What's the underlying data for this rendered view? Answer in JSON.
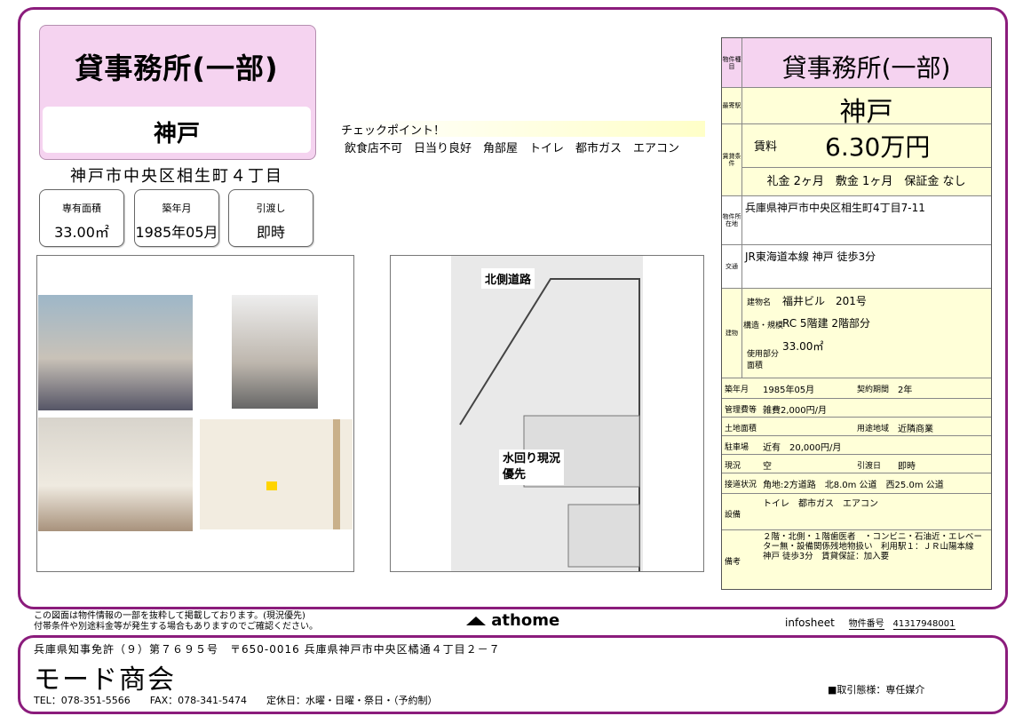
{
  "header": {
    "title": "貸事務所(一部)",
    "area": "神戸",
    "address": "神戸市中央区相生町４丁目"
  },
  "badges": [
    {
      "label": "専有面積",
      "value": "33.00㎡"
    },
    {
      "label": "築年月",
      "value": "1985年05月"
    },
    {
      "label": "引渡し",
      "value": "即時"
    }
  ],
  "checkpoint": {
    "title": "チェックポイント！",
    "items": "飲食店不可　日当り良好　角部屋　トイレ　都市ガス　エアコン"
  },
  "floorplan": {
    "north_road": "北側道路",
    "note1": "水回り現況",
    "note2": "優先"
  },
  "table": {
    "type_label": "物件種目",
    "type": "貸事務所(一部)",
    "station_label": "最寄駅",
    "station": "神戸",
    "rent_cond_label": "賃貸条件",
    "rent_label": "賃料",
    "rent": "6.30万円",
    "deposit": "礼金 2ヶ月　敷金 1ヶ月　保証金 なし",
    "loc_label": "物件所在地",
    "location": "兵庫県神戸市中央区相生町4丁目7-11",
    "access_label": "交通",
    "access": "JR東海道本線 神戸 徒歩3分",
    "bld_label": "建物",
    "bld_name_label": "建物名",
    "bld_name": "福井ビル　201号",
    "struct_label": "構造・規模",
    "struct": "RC 5階建 2階部分",
    "usage_label": "使用部分面積",
    "usage": "33.00㎡",
    "built_label": "築年月",
    "built": "1985年05月",
    "term_label": "契約期間",
    "term": "2年",
    "mgmt_label": "管理費等",
    "mgmt": "雑費2,000円/月",
    "land_label": "土地面積",
    "zone_label": "用途地域",
    "zone": "近隣商業",
    "parking_label": "駐車場",
    "parking": "近有　20,000円/月",
    "status_label": "現況",
    "status": "空",
    "handover_label": "引渡日",
    "handover": "即時",
    "road_label": "接道状況",
    "road": "角地:2方道路　北8.0m 公道　西25.0m 公道",
    "equip_label": "設備",
    "equip": "トイレ　都市ガス　エアコン",
    "remarks_label": "備考",
    "remarks": "２階・北側・１階歯医者　・コンビニ・石油近・エレベーター無・設備関係残地物扱い　利用駅１：ＪＲ山陽本線 神戸 徒歩3分　賃貸保証：加入要"
  },
  "footer": {
    "note1": "この図面は物件情報の一部を抜粋して掲載しております。(現況優先)",
    "note2": "付帯条件や別途料金等が発生する場合もありますのでご確認ください。",
    "logo": "athome",
    "infosheet": "infosheet",
    "number_label": "物件番号",
    "number": "41317948001",
    "license": "兵庫県知事免許（９）第７６９５号　〒650-0016 兵庫県神戸市中央区橘通４丁目２－７",
    "company": "モード商会",
    "contact": "TEL：078-351-5566　　FAX：078-341-5474　　定休日：水曜・日曜・祭日・（予約制）",
    "deal": "■取引態様：専任媒介"
  },
  "colors": {
    "frame": "#8b1c7c",
    "title_bg": "#f5d3f0",
    "table_bg": "#ffffd8"
  }
}
